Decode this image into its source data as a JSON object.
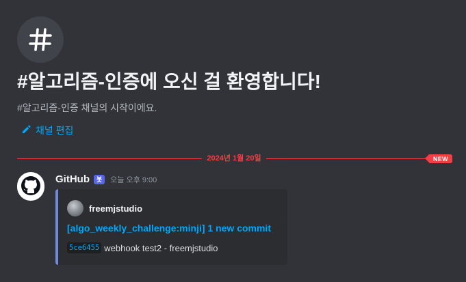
{
  "welcome": {
    "title": "#알고리즘-인증에 오신 걸 환영합니다!",
    "subtitle": "#알고리즘-인증 채널의 시작이에요.",
    "edit_label": "채널 편집",
    "icon": "hashtag-icon"
  },
  "divider": {
    "date": "2024년 1월 20일",
    "badge": "NEW",
    "color": "#f23f43"
  },
  "message": {
    "author": "GitHub",
    "bot_tag": "봇",
    "timestamp": "오늘 오후 9:00",
    "avatar_icon": "github-icon",
    "embed": {
      "author_name": "freemjstudio",
      "title": "[algo_weekly_challenge:minji] 1 new commit",
      "commit_hash": "5ce6455",
      "commit_message": "webhook test2 - freemjstudio",
      "accent_color": "#7289da",
      "link_color": "#00a8fc"
    }
  }
}
